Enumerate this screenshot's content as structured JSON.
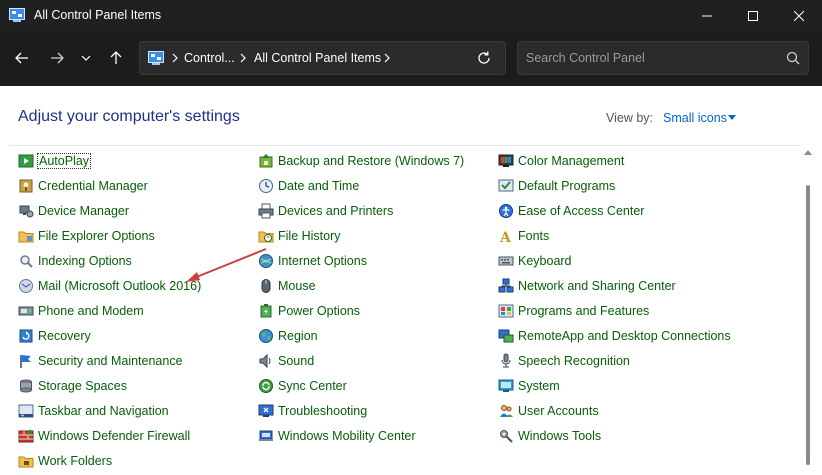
{
  "window": {
    "title": "All Control Panel Items"
  },
  "navigation": {
    "breadcrumbs": [
      "Control...",
      "All Control Panel Items"
    ],
    "search_placeholder": "Search Control Panel"
  },
  "main": {
    "heading": "Adjust your computer's settings",
    "view_by_label": "View by:",
    "view_by_value": "Small icons",
    "columns": [
      [
        {
          "label": "AutoPlay",
          "icon": "autoplay-icon"
        },
        {
          "label": "Credential Manager",
          "icon": "credential-manager-icon"
        },
        {
          "label": "Device Manager",
          "icon": "device-manager-icon"
        },
        {
          "label": "File Explorer Options",
          "icon": "folder-options-icon"
        },
        {
          "label": "Indexing Options",
          "icon": "indexing-icon"
        },
        {
          "label": "Mail (Microsoft Outlook 2016)",
          "icon": "mail-icon"
        },
        {
          "label": "Phone and Modem",
          "icon": "phone-modem-icon"
        },
        {
          "label": "Recovery",
          "icon": "recovery-icon"
        },
        {
          "label": "Security and Maintenance",
          "icon": "flag-icon"
        },
        {
          "label": "Storage Spaces",
          "icon": "storage-icon"
        },
        {
          "label": "Taskbar and Navigation",
          "icon": "taskbar-icon"
        },
        {
          "label": "Windows Defender Firewall",
          "icon": "firewall-icon"
        },
        {
          "label": "Work Folders",
          "icon": "work-folders-icon"
        }
      ],
      [
        {
          "label": "Backup and Restore (Windows 7)",
          "icon": "backup-icon"
        },
        {
          "label": "Date and Time",
          "icon": "clock-icon"
        },
        {
          "label": "Devices and Printers",
          "icon": "printer-icon"
        },
        {
          "label": "File History",
          "icon": "file-history-icon"
        },
        {
          "label": "Internet Options",
          "icon": "globe-icon"
        },
        {
          "label": "Mouse",
          "icon": "mouse-icon"
        },
        {
          "label": "Power Options",
          "icon": "power-icon"
        },
        {
          "label": "Region",
          "icon": "region-icon"
        },
        {
          "label": "Sound",
          "icon": "speaker-icon"
        },
        {
          "label": "Sync Center",
          "icon": "sync-icon"
        },
        {
          "label": "Troubleshooting",
          "icon": "troubleshooting-icon"
        },
        {
          "label": "Windows Mobility Center",
          "icon": "mobility-icon"
        }
      ],
      [
        {
          "label": "Color Management",
          "icon": "color-management-icon"
        },
        {
          "label": "Default Programs",
          "icon": "default-programs-icon"
        },
        {
          "label": "Ease of Access Center",
          "icon": "ease-of-access-icon"
        },
        {
          "label": "Fonts",
          "icon": "fonts-icon"
        },
        {
          "label": "Keyboard",
          "icon": "keyboard-icon"
        },
        {
          "label": "Network and Sharing Center",
          "icon": "network-icon"
        },
        {
          "label": "Programs and Features",
          "icon": "programs-icon"
        },
        {
          "label": "RemoteApp and Desktop Connections",
          "icon": "remoteapp-icon"
        },
        {
          "label": "Speech Recognition",
          "icon": "microphone-icon"
        },
        {
          "label": "System",
          "icon": "system-icon"
        },
        {
          "label": "User Accounts",
          "icon": "users-icon"
        },
        {
          "label": "Windows Tools",
          "icon": "tools-icon"
        }
      ]
    ]
  },
  "colors": {
    "titlebar_bg": "#202020",
    "link_green": "#075e08",
    "heading_blue": "#1e3287",
    "accent_blue": "#0066cc",
    "annotation_arrow": "#d04040"
  }
}
